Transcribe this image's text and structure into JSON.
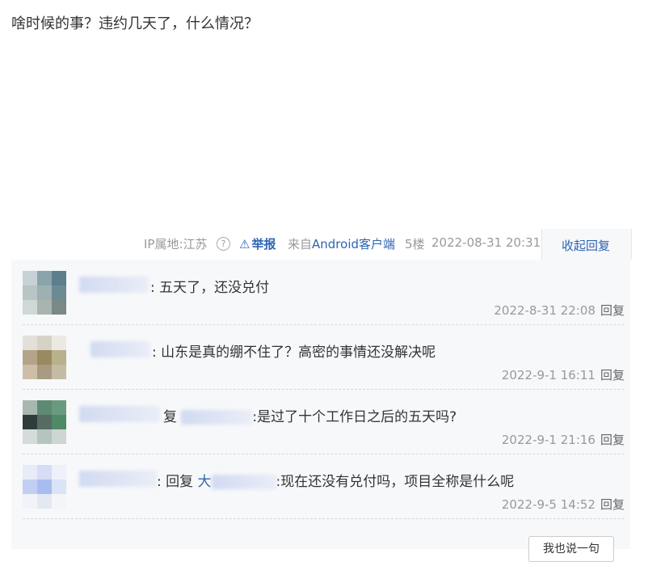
{
  "post": {
    "content": "啥时候的事？违约几天了，什么情况？",
    "ip_location": "IP属地:江苏",
    "report_label": "举报",
    "source_prefix": "来自",
    "source_client": "Android客户端",
    "floor": "5楼",
    "time": "2022-08-31 20:31",
    "collapse_label": "收起回复"
  },
  "comments": [
    {
      "text_after_name": ": 五天了，还没兑付",
      "reply_to": "",
      "time": "2022-8-31 22:08",
      "reply_label": "回复"
    },
    {
      "text_after_name": ": 山东是真的绷不住了？高密的事情还没解决呢",
      "reply_to": "",
      "time": "2022-9-1 16:11",
      "reply_label": "回复"
    },
    {
      "reply_prefix": "复",
      "text_after_name": ":是过了十个工作日之后的五天吗?",
      "time": "2022-9-1 21:16",
      "reply_label": "回复"
    },
    {
      "reply_prefix": ": 回复",
      "reply_to_visible": "大",
      "text_after_name": ":现在还没有兑付吗，项目全称是什么呢",
      "time": "2022-9-5 14:52",
      "reply_label": "回复"
    }
  ],
  "say_button": "我也说一句",
  "colors": {
    "link_blue": "#2d64b3",
    "meta_gray": "#999999",
    "comment_bg": "#f7f8fa"
  },
  "icons": {
    "help": "question-circle-icon",
    "report": "warning-triangle-icon"
  }
}
